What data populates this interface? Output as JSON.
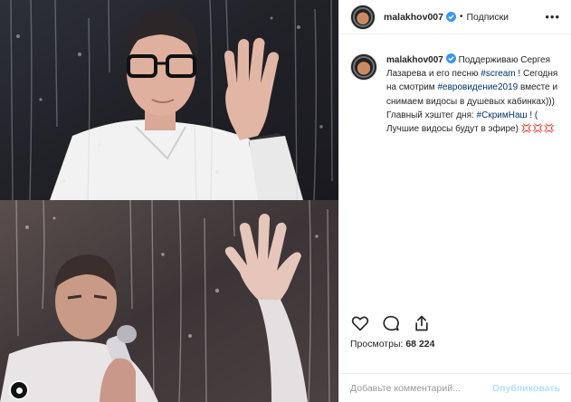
{
  "header": {
    "username": "malakhov007",
    "separator": "•",
    "follow_label": "Подписки",
    "more_label": "•••"
  },
  "caption": {
    "username": "malakhov007",
    "text_1": " Поддерживаю Сергея Лазарева и его песню ",
    "tag_1": "#scream",
    "text_2": " ! Сегодня на смотрим ",
    "tag_2": "#евровидение2019",
    "text_3": " вместе и снимаем видосы в душевых кабинках))) Главный хэштег дня: ",
    "tag_3": "#СкримНаш",
    "text_4": " ! ( Лучшие видосы будут в эфире) ",
    "emoji": "💢💢💢"
  },
  "stats": {
    "views_label": "Просмотры:",
    "views_value": "68 224"
  },
  "comment": {
    "placeholder": "Добавьте комментарий...",
    "post_label": "Опубликовать"
  },
  "colors": {
    "link": "#003569",
    "verified": "#3897f0",
    "post_disabled": "#b2dffc"
  },
  "icons": [
    "verified-icon",
    "heart-icon",
    "comment-icon",
    "share-icon",
    "video-indicator-icon"
  ]
}
